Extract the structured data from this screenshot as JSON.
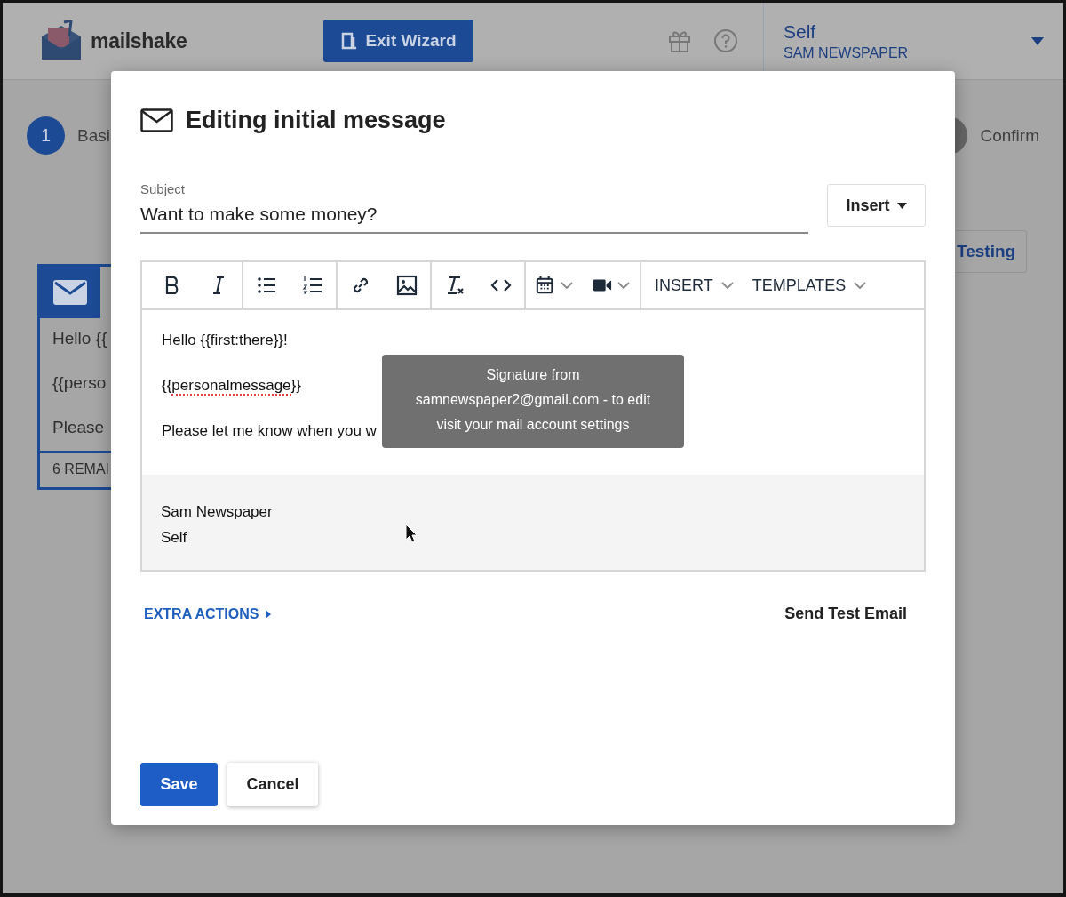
{
  "header": {
    "logo_text": "mailshake",
    "exit_button": "Exit Wizard",
    "account_name": "Self",
    "account_org": "SAM NEWSPAPER"
  },
  "wizard": {
    "steps": [
      {
        "number": "1",
        "label": "Basi",
        "selected": true
      },
      {
        "label": "Confirm",
        "selected": false
      }
    ],
    "testing_button": "Testing",
    "message_card": {
      "lines": [
        "Hello {{",
        "{{perso",
        "Please"
      ],
      "footer": "6 REMAI"
    }
  },
  "modal": {
    "title": "Editing initial message",
    "subject_label": "Subject",
    "subject_value": "Want to make some money?",
    "insert_button": "Insert",
    "toolbar_menus": [
      "INSERT",
      "TEMPLATES"
    ],
    "body_lines": [
      {
        "parts": [
          {
            "text": "Hello {{first:there}}!",
            "misspelled": false
          }
        ]
      },
      {
        "parts": [
          {
            "text": "{{",
            "misspelled": false
          },
          {
            "text": "personalmessage",
            "misspelled": true
          },
          {
            "text": "}}",
            "misspelled": false
          }
        ]
      },
      {
        "parts": [
          {
            "text": "Please let me know when you w",
            "misspelled": false
          }
        ]
      }
    ],
    "signature": [
      "Sam Newspaper",
      "Self"
    ],
    "tooltip": [
      "Signature from",
      "samnewspaper2@gmail.com - to edit",
      "visit your mail account settings"
    ],
    "extra_actions": "EXTRA ACTIONS",
    "send_test": "Send Test Email",
    "buttons": [
      {
        "label": "Save",
        "kind": "primary"
      },
      {
        "label": "Cancel",
        "kind": "secondary"
      }
    ]
  }
}
